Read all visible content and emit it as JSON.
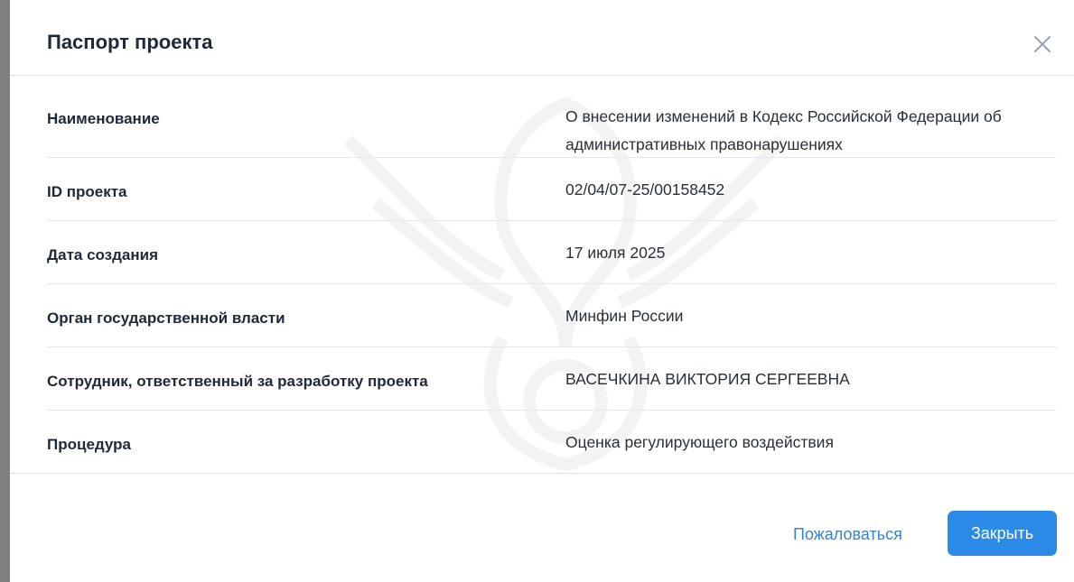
{
  "modal": {
    "title": "Паспорт проекта",
    "close_icon": "close-icon",
    "rows": [
      {
        "label": "Наименование",
        "value": "О внесении изменений в Кодекс Российской Федерации об административных правонарушениях"
      },
      {
        "label": "ID проекта",
        "value": "02/04/07-25/00158452"
      },
      {
        "label": "Дата создания",
        "value": "17 июля 2025"
      },
      {
        "label": "Орган государственной власти",
        "value": "Минфин России"
      },
      {
        "label": "Сотрудник, ответственный за разработку проекта",
        "value": "ВАСЕЧКИНА ВИКТОРИЯ СЕРГЕЕВНА"
      },
      {
        "label": "Процедура",
        "value": "Оценка регулирующего воздействия"
      }
    ],
    "footer": {
      "complain_label": "Пожаловаться",
      "close_label": "Закрыть"
    }
  },
  "colors": {
    "accent": "#2b8ae8",
    "link": "#3b82c8",
    "title": "#1f2937",
    "overlay": "#7f7f80"
  }
}
